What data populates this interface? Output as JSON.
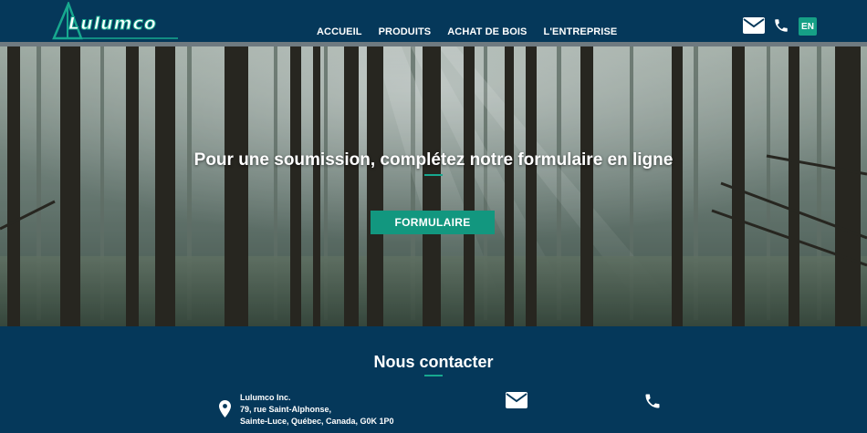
{
  "brand": {
    "logo_text": "Lulumco"
  },
  "nav": {
    "items": [
      {
        "label": "ACCUEIL"
      },
      {
        "label": "PRODUITS"
      },
      {
        "label": "ACHAT DE BOIS"
      },
      {
        "label": "L'ENTREPRISE"
      }
    ]
  },
  "header_actions": {
    "language_label": "EN",
    "email_icon": "envelope-icon",
    "phone_icon": "phone-icon"
  },
  "hero": {
    "title": "Pour une soumission, complétez notre formulaire en ligne",
    "button_label": "FORMULAIRE"
  },
  "contact": {
    "title": "Nous contacter",
    "company": "Lulumco Inc.",
    "street": "79, rue Saint-Alphonse,",
    "city": "Sainte-Luce, Québec, Canada, G0K 1P0",
    "location_icon": "map-pin-icon",
    "email_icon": "envelope-icon",
    "phone_icon": "phone-icon"
  },
  "colors": {
    "navy": "#05385a",
    "teal": "#17a88f",
    "button": "#12977f"
  }
}
